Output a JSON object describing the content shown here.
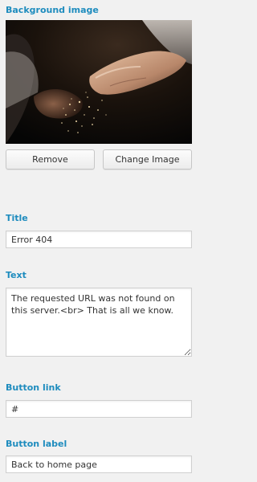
{
  "background_image": {
    "label": "Background image",
    "remove_label": "Remove",
    "change_label": "Change Image"
  },
  "title_field": {
    "label": "Title",
    "value": "Error 404"
  },
  "text_field": {
    "label": "Text",
    "value": "The requested URL was not found on this server.<br> That is all we know."
  },
  "button_link_field": {
    "label": "Button link",
    "value": "#"
  },
  "button_label_field": {
    "label": "Button label",
    "value": "Back to home page"
  },
  "colors": {
    "section_label": "#1e8cbe",
    "panel_background": "#f1f1f1"
  }
}
